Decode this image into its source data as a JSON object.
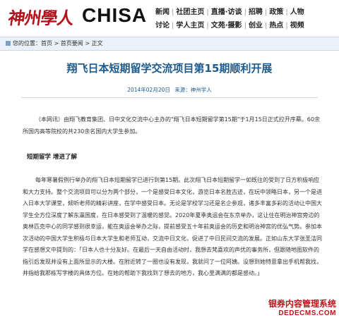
{
  "header": {
    "logo_cn": "神州學人",
    "logo_en": "CHISA",
    "nav_rows": [
      [
        "新闻",
        "社团主页",
        "直播·访谈",
        "招聘",
        "政策",
        "人物"
      ],
      [
        "讨论",
        "学人主页",
        "文苑·摄影",
        "创业",
        "热点",
        "视频"
      ]
    ]
  },
  "breadcrumb": {
    "prefix": "您的位置：",
    "items": [
      "首页",
      "首页要闻",
      "正文"
    ],
    "separator": " > "
  },
  "article": {
    "title": "翔飞日本短期留学交流项目第15期顺利开展",
    "date": "2014年02月20日",
    "source": "来源：神州学人",
    "para1": "（本网讯）由翔飞教育集团、日中文化交流中心主办的\"翔飞日本短期留学第15期\"于1月15日正式拉开序幕。60余所国内高等院校的共230余名国内大学生参加。",
    "subhead": "短期留学  增进了解",
    "para2": "每年寒暑假例行举办的翔飞日本短期留学已进行到第15期。此次翔飞日本短期留学一如既往的受到了日方积极响应和大力支持。整个交流项目可以分为两个部分，一个是感受日本文化，游览日本名胜古迹，在玩中领略日本，另一个是进入日本大学课堂，倾听老师的精彩讲座，在学中感受日本。无论是学校学习还是名企参观，诸多丰富多彩的活动让中国大学生全方位深度了解东瀛国度，在日本感受到了温暖的感觉。2020年夏季奥运会在东京举办，这让住在明治神宫旁边的奥林匹克中心的同学感到很幸运，能在奥运会举办之际，提前感受五十年前奥运会的历史和明治神宫的优弘气势。参加本次活动的中国大学生积极与日本大学生和老师互动，交流中日文化，促进了中日民间交流的发展。正如山东大学张圣洁同学在感想文中提到的：「日本人也十分友好。在最后一天自由活动时，我想去梵喜欢的声优的事务所，但跟随地图软件的指引后发现并没有上面所显示的大楼。在附近转了一圈也没有发现，我就问了一位阿姨。没想到她特意拿出手机帮我找，并指给我那栋写字楼的具体方位。在她的帮助下我找到了想去的地方，我心里满满的都是感动。」"
  },
  "watermark": {
    "line1": "银券内容管理系统",
    "line2": "DEDECMS.COM"
  }
}
